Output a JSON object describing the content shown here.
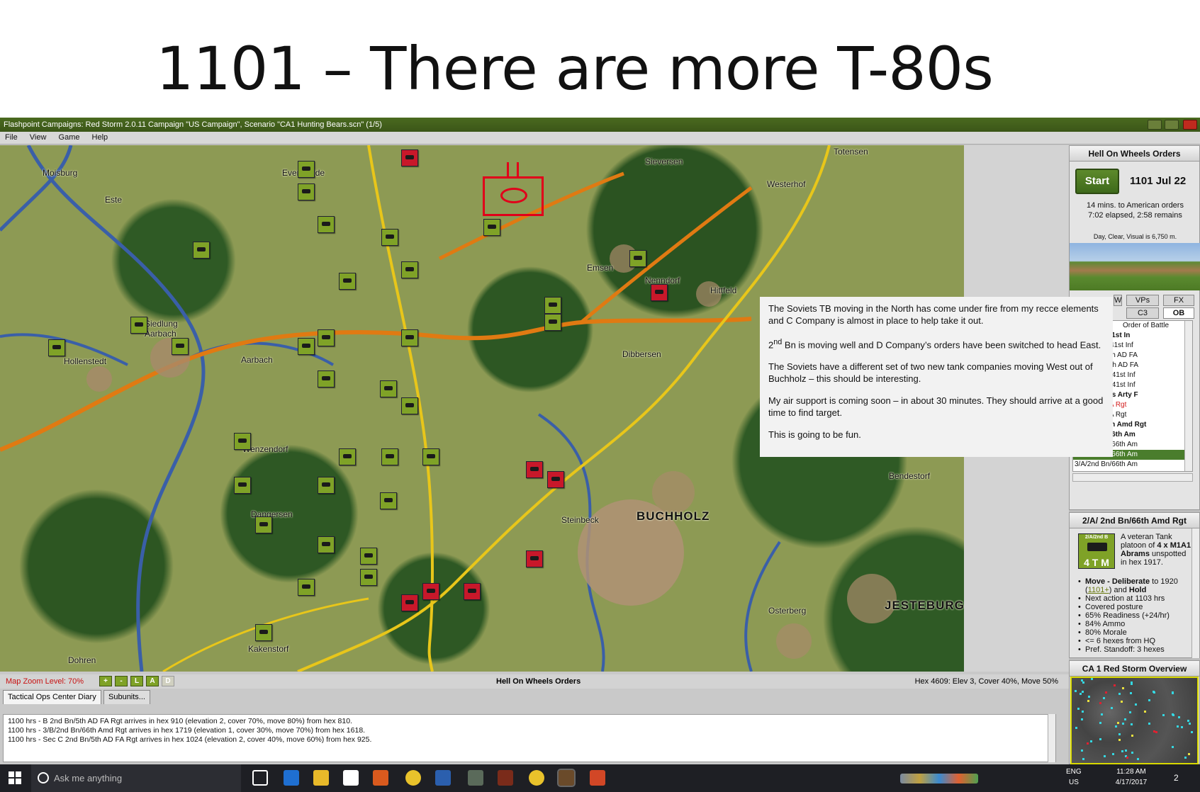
{
  "slide": {
    "title": "1101 – There are more T-80s"
  },
  "window": {
    "title": "Flashpoint Campaigns: Red Storm  2.0.11  Campaign \"US Campaign\", Scenario \"CA1 Hunting Bears.scn\" (1/5)",
    "menu": [
      "File",
      "View",
      "Game",
      "Help"
    ]
  },
  "map": {
    "places": [
      "Moisburg",
      "Eversdelde",
      "Totensen",
      "Westerhof",
      "Emsen",
      "Nenndorf",
      "Hittfeld",
      "Siedlung Aarbach",
      "Hollenstedt",
      "Dibbersen",
      "Wenzendorf",
      "Dangersen",
      "Steinbeck",
      "BUCHHOLZ",
      "Bendestorf",
      "Osterberg",
      "JESTEBURG",
      "Dohren",
      "Aarbach",
      "Este",
      "Sieversen",
      "Kakenstorf"
    ],
    "highlight": "red box and ellipse around newly spotted T-80 company"
  },
  "note": {
    "p1": "The Soviets TB moving in the North has come under fire from my recce elements and C Company is almost in place to help take it out.",
    "p2_prefix": "2",
    "p2_sup": "nd",
    "p2_rest": " Bn is moving well and D Company’s orders have been switched to head East.",
    "p3": "The Soviets have a different set of two new tank companies moving West out of Buchholz – this should be interesting.",
    "p4": "My air support is coming soon – in about 30 minutes.  They should arrive at a good time to find target.",
    "p5": "This is going to be fun."
  },
  "orders_panel": {
    "title": "Hell On Wheels Orders",
    "start_label": "Start",
    "turn_date": "1101 Jul 22",
    "line1": "14 mins. to American orders",
    "line2": "7:02 elapsed, 2:58 remains",
    "weather": "Day, Clear, Visual is 6,750 m.",
    "tabs_top": [
      "W",
      "VPs",
      "FX"
    ],
    "tabs_bottom": [
      "C3",
      "OB"
    ],
    "ob_header": "Order of Battle",
    "ob_rows": [
      "D/4th Bn/ 41st In",
      "4/D/4th Bn/41st Inf",
      "B 2nd Bn/5th AD FA",
      "G 2nd Bn/5th AD FA",
      "2/D/4th Bn/ 41st Inf",
      "3/D/4th Bn/ 41st Inf",
      "ll on Wheels Arty F",
      "th Bn/3rd FA Rgt",
      "th Bn/3rd FA Rgt",
      "2nd Bn/66th Amd Rgt",
      "A/2nd Bn/66th Am",
      "1/A/2nd Bn/66th Am",
      "2/A/2nd Bn/66th Am",
      "3/A/2nd Bn/66th Am"
    ]
  },
  "unit_panel": {
    "title": "2/A/ 2nd Bn/66th Amd Rgt",
    "counter_label": "2/A/2nd B",
    "strength": "4 T M",
    "desc1": "A veteran Tank platoon of ",
    "desc_bold": "4 x M1A1 Abrams",
    "desc2": " unspotted in hex 1917.",
    "move_bold": "Move - Deliberate",
    "move_to": " to 1920 (",
    "move_link": "1101+",
    "move_and": ") and ",
    "move_hold": "Hold",
    "stats": [
      "Next action at 1103 hrs",
      "Covered posture",
      "65% Readiness (+24/hr)",
      "84% Ammo",
      "80% Morale",
      "<= 6 hexes from HQ",
      "Pref. Standoff: 3 hexes"
    ]
  },
  "overview": {
    "title": "CA 1 Red Storm Overview"
  },
  "statusbar": {
    "zoom": "Map Zoom Level: 70%",
    "zoom_buttons": [
      "+",
      "-",
      "L",
      "A",
      "D"
    ],
    "title": "Hell On Wheels Orders",
    "hex_info": "Hex 4609: Elev 3, Cover 40%, Move 50%"
  },
  "diary": {
    "tabs": [
      "Tactical Ops Center Diary",
      "Subunits..."
    ],
    "lines": [
      "1100 hrs - B 2nd Bn/5th AD FA Rgt arrives in hex 910 (elevation 2, cover 70%, move 80%) from hex 810.",
      "1100 hrs - 3/B/2nd Bn/66th Amd Rgt arrives in hex 1719 (elevation 1, cover 30%, move 70%) from hex 1618.",
      "1100 hrs - Sec C 2nd Bn/5th AD FA Rgt arrives in hex 1024 (elevation 2, cover 40%, move 60%) from hex 925."
    ]
  },
  "taskbar": {
    "search_placeholder": "Ask me anything",
    "lang": "ENG",
    "region": "US",
    "time": "11:28 AM",
    "date": "4/17/2017",
    "notifications": "2"
  },
  "colors": {
    "us_unit": "#7fa227",
    "soviet_unit": "#c8182a",
    "title_bar": "#3b5618",
    "highlight": "#e1001a"
  }
}
